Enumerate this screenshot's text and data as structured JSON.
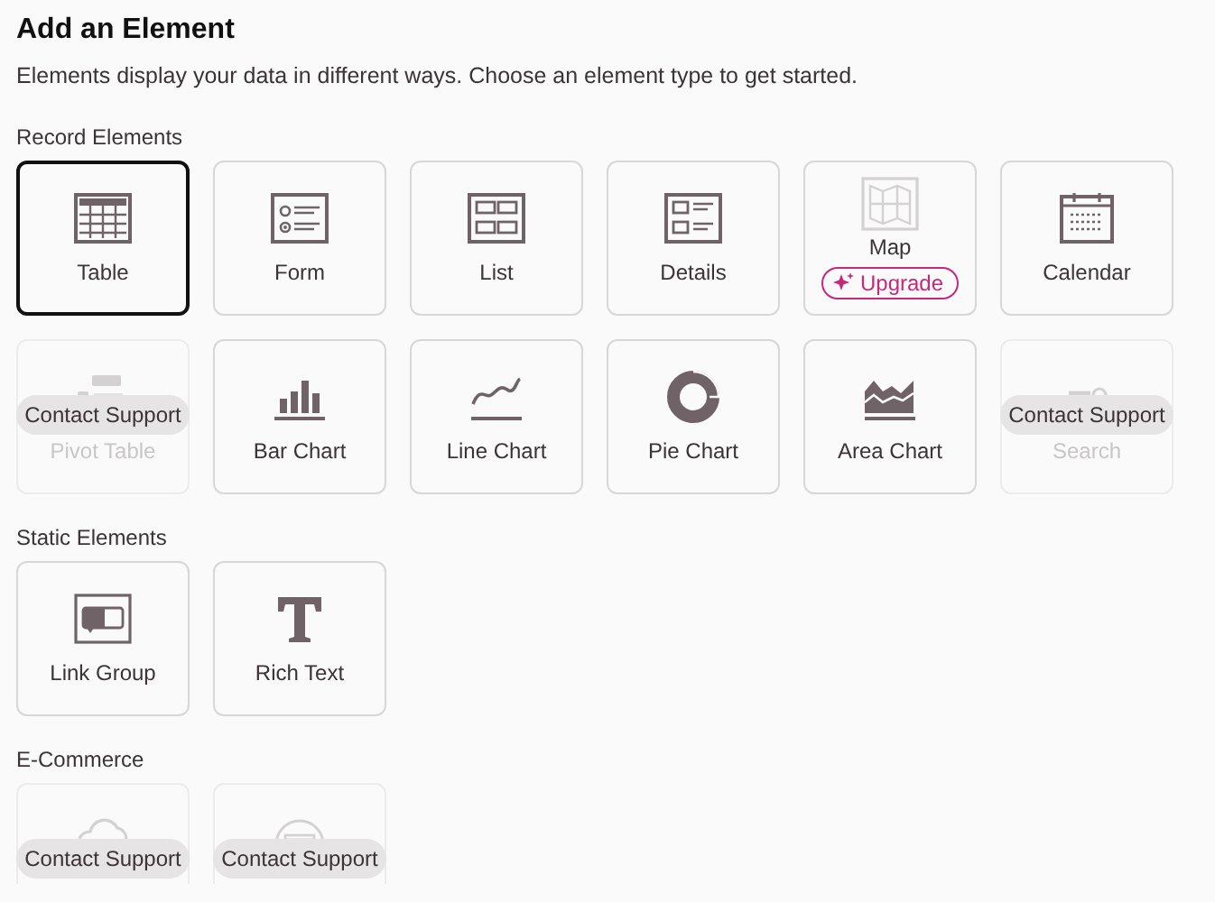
{
  "title": "Add an Element",
  "description": "Elements display your data in different ways. Choose an element type to get started.",
  "sections": [
    {
      "heading": "Record Elements",
      "cards": [
        {
          "kind": "normal",
          "label": "Table",
          "selected": true
        },
        {
          "kind": "normal",
          "label": "Form",
          "selected": false
        },
        {
          "kind": "normal",
          "label": "List",
          "selected": false
        },
        {
          "kind": "normal",
          "label": "Details",
          "selected": false
        },
        {
          "kind": "upgrade",
          "label": "Map",
          "badge": "Upgrade",
          "selected": false
        },
        {
          "kind": "normal",
          "label": "Calendar",
          "selected": false
        },
        {
          "kind": "locked",
          "label": "Pivot Table",
          "badge": "Contact Support",
          "selected": false
        },
        {
          "kind": "normal",
          "label": "Bar Chart",
          "selected": false
        },
        {
          "kind": "normal",
          "label": "Line Chart",
          "selected": false
        },
        {
          "kind": "normal",
          "label": "Pie Chart",
          "selected": false
        },
        {
          "kind": "normal",
          "label": "Area Chart",
          "selected": false
        },
        {
          "kind": "locked",
          "label": "Search",
          "badge": "Contact Support",
          "selected": false
        }
      ]
    },
    {
      "heading": "Static Elements",
      "cards": [
        {
          "kind": "normal",
          "label": "Link Group",
          "selected": false
        },
        {
          "kind": "normal",
          "label": "Rich Text",
          "selected": false
        }
      ]
    },
    {
      "heading": "E-Commerce",
      "cards": [
        {
          "kind": "locked",
          "badge": "Contact Support",
          "selected": false
        },
        {
          "kind": "locked",
          "badge": "Contact Support",
          "selected": false
        }
      ]
    }
  ]
}
